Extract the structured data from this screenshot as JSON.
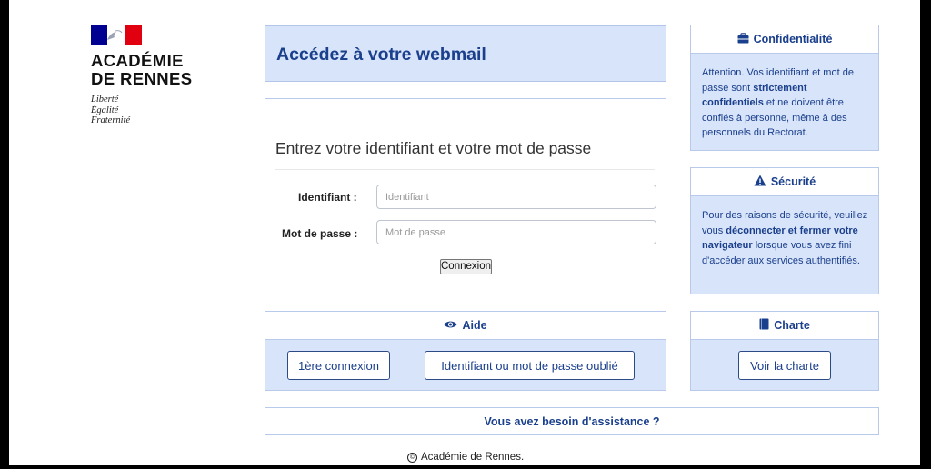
{
  "logo": {
    "name_line1": "ACADÉMIE",
    "name_line2": "DE RENNES",
    "motto_1": "Liberté",
    "motto_2": "Égalité",
    "motto_3": "Fraternité"
  },
  "header": {
    "title": "Accédez à votre webmail"
  },
  "login": {
    "heading": "Entrez votre identifiant et votre mot de passe",
    "username_label": "Identifiant :",
    "username_placeholder": "Identifiant",
    "password_label": "Mot de passe :",
    "password_placeholder": "Mot de passe",
    "submit_label": "Connexion"
  },
  "confidentialite": {
    "title": "Confidentialité",
    "icon": "briefcase-icon",
    "text_1": "Attention. Vos identifiant et mot de passe sont ",
    "text_bold": "strictement confidentiels",
    "text_2": " et ne doivent être confiés à personne, même à des personnels du Rectorat."
  },
  "securite": {
    "title": "Sécurité",
    "icon": "warning-icon",
    "text_1": "Pour des raisons de sécurité, veuillez vous ",
    "text_bold": "déconnecter et fermer votre navigateur",
    "text_2": " lorsque vous avez fini d'accéder aux services authentifiés."
  },
  "aide": {
    "title": "Aide",
    "icon": "eye-icon",
    "first_login_label": "1ère connexion",
    "forgot_label": "Identifiant ou mot de passe oublié"
  },
  "charte": {
    "title": "Charte",
    "icon": "book-icon",
    "view_label": "Voir la charte"
  },
  "assistance": {
    "label": "Vous avez besoin d'assistance ?"
  },
  "footer": {
    "copyright_symbol": "©",
    "text": "Académie de Rennes."
  },
  "colors": {
    "accent": "#1a3f8c",
    "panel_bg": "#d8e4f9",
    "panel_border": "#b9c9ea",
    "flag_blue": "#000091",
    "flag_red": "#e1000f"
  }
}
